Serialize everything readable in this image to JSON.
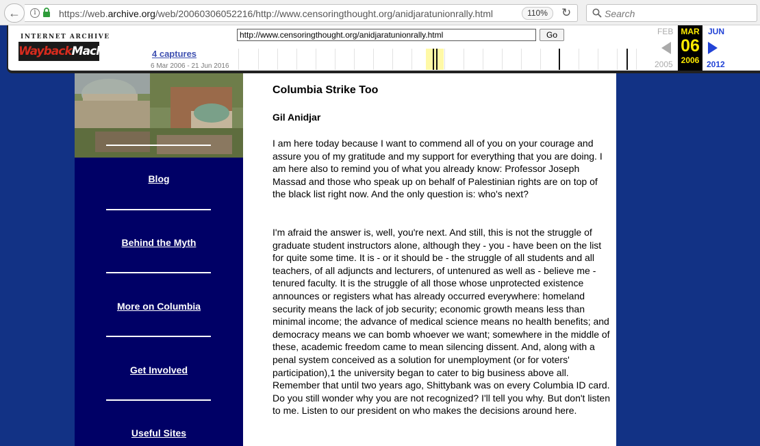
{
  "browser": {
    "url_prefix": "https://web.",
    "url_host": "archive.org",
    "url_rest": "/web/20060306052216/http://www.censoringthought.org/anidjaratunionrally.html",
    "zoom": "110%",
    "search_placeholder": "Search"
  },
  "wayback": {
    "logo_top": "INTERNET ARCHIVE",
    "logo_main": "Wayback",
    "logo_machine": "Machine",
    "url_value": "http://www.censoringthought.org/anidjaratunionrally.html",
    "go_label": "Go",
    "captures": "4 captures",
    "range": "6 Mar 2006 - 21 Jun 2016",
    "prev_month": "FEB",
    "prev_year": "2005",
    "cur_month": "MAR",
    "cur_day": "06",
    "cur_year": "2006",
    "next_month": "JUN",
    "next_year": "2012"
  },
  "sidebar": {
    "items": [
      {
        "label": "Blog"
      },
      {
        "label": "Behind the Myth"
      },
      {
        "label": "More on Columbia"
      },
      {
        "label": "Get Involved"
      },
      {
        "label": "Useful Sites"
      }
    ]
  },
  "article": {
    "title": "Columbia Strike Too",
    "author": "Gil Anidjar",
    "paragraphs": [
      "I am here today because I want to commend all of you on your courage and assure you of my gratitude and my support for everything that you are doing. I am here also to remind you of what you already know: Professor Joseph Massad and those who speak up on behalf of Palestinian rights are on top of the black list right now. And the only question is: who's next?",
      "I'm afraid the answer is, well, you're next. And still, this is not the struggle of graduate student instructors alone, although they - you - have been on the list for quite some time. It is - or it should be - the struggle of all students and all teachers, of all adjuncts and lecturers, of untenured as well as - believe me - tenured faculty. It is the struggle of all those whose unprotected existence announces or registers what has already occurred everywhere: homeland security means the lack of job security; economic growth means less than minimal income; the advance of medical science means no health benefits; and democracy means we can bomb whoever we want; somewhere in the middle of these, academic freedom came to mean silencing dissent. And, along with a penal system conceived as a solution for unemployment (or for voters' participation),1 the university began to cater to big business above all. Remember that until two years ago, Shittybank was on every Columbia ID card. Do you still wonder why you are not recognized? I'll tell you why. But don't listen to me. Listen to our president on who makes the decisions around here."
    ]
  }
}
